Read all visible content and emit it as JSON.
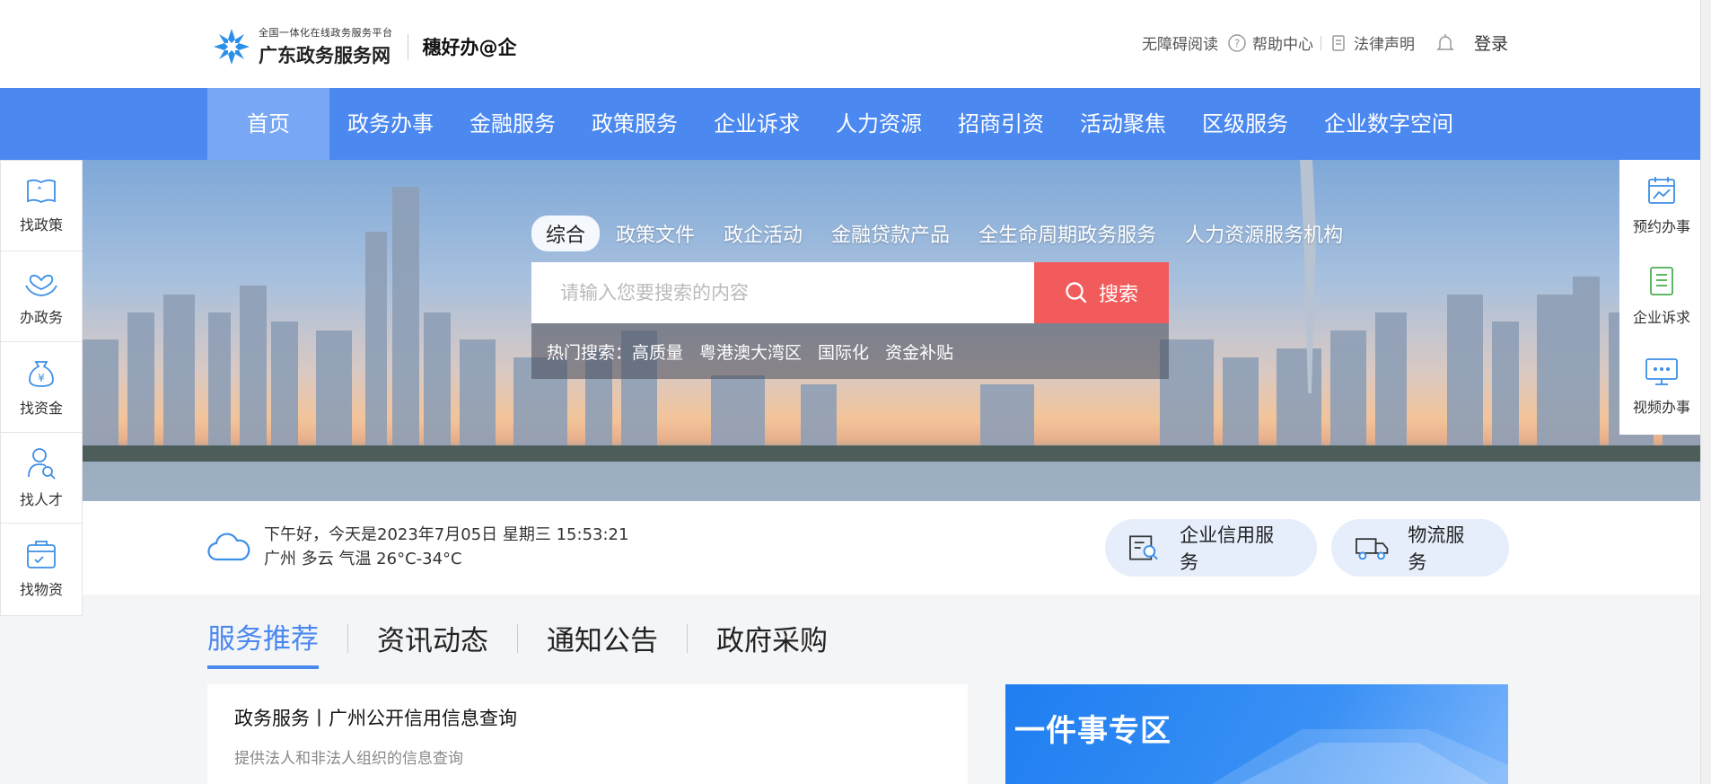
{
  "header": {
    "logo_small": "全国一体化在线政务服务平台",
    "logo_big": "广东政务服务网",
    "slogan": "穗好办@企",
    "links": {
      "accessibility": "无障碍阅读",
      "help": "帮助中心",
      "legal": "法律声明",
      "login": "登录"
    }
  },
  "nav": {
    "items": [
      "首页",
      "政务办事",
      "金融服务",
      "政策服务",
      "企业诉求",
      "人力资源",
      "招商引资",
      "活动聚焦",
      "区级服务",
      "企业数字空间"
    ]
  },
  "search": {
    "tabs": [
      "综合",
      "政策文件",
      "政企活动",
      "金融贷款产品",
      "全生命周期政务服务",
      "人力资源服务机构"
    ],
    "placeholder": "请输入您要搜索的内容",
    "button": "搜索",
    "hot_label": "热门搜索：",
    "hot_items": [
      "高质量",
      "粤港澳大湾区",
      "国际化",
      "资金补贴"
    ]
  },
  "weather": {
    "greeting": "下午好，今天是2023年7月05日 星期三 15:53:21",
    "detail": "广州  多云  气温  26°C-34°C"
  },
  "quick_services": {
    "credit": "企业信用服务",
    "logistics": "物流服务"
  },
  "left_float": {
    "items": [
      "找政策",
      "办政务",
      "找资金",
      "找人才",
      "找物资"
    ]
  },
  "right_float": {
    "items": [
      "预约办事",
      "企业诉求",
      "视频办事"
    ]
  },
  "section_tabs": [
    "服务推荐",
    "资讯动态",
    "通知公告",
    "政府采购"
  ],
  "card": {
    "title": "政务服务丨广州公开信用信息查询",
    "desc": "提供法人和非法人组织的信息查询"
  },
  "promo": {
    "title": "一件事专区"
  },
  "colors": {
    "primary": "#4b88f0",
    "search_button": "#f25b5b",
    "nav_active": "#78a7f5"
  }
}
